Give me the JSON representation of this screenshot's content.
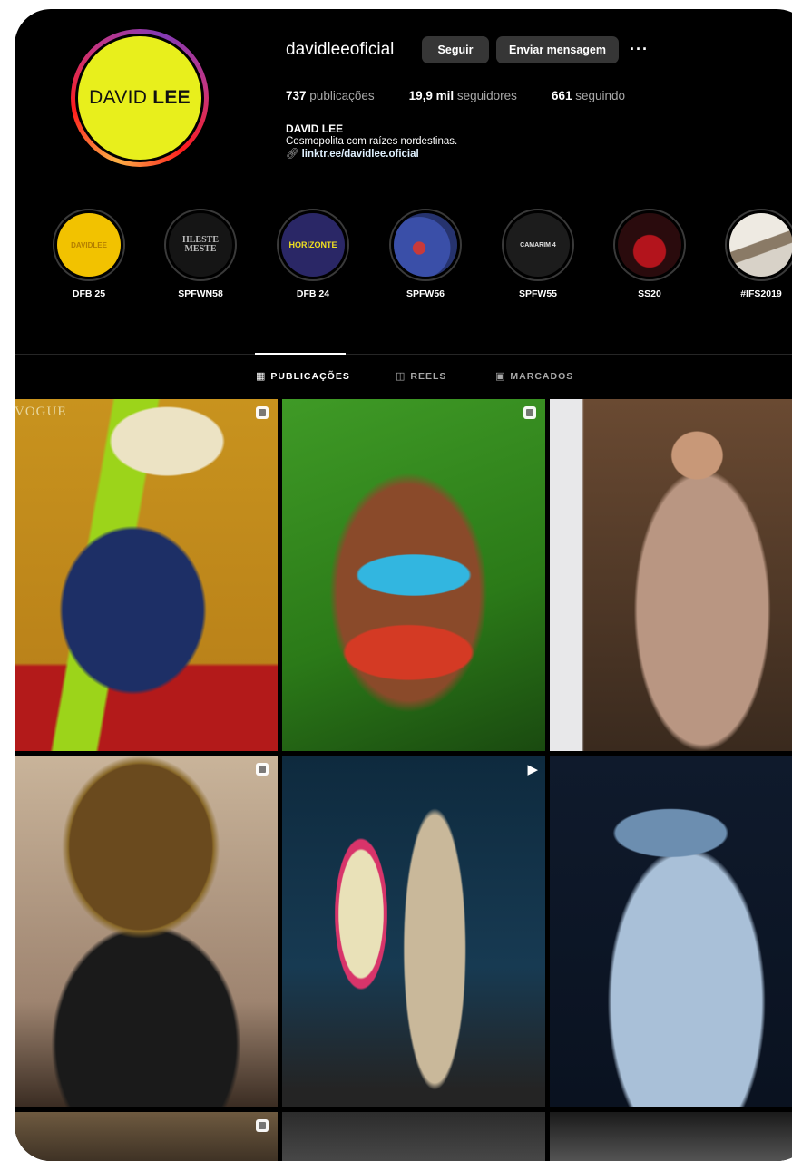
{
  "profile": {
    "username": "davidleeoficial",
    "avatar_text_light": "DAVID",
    "avatar_text_bold": "LEE",
    "follow_label": "Seguir",
    "message_label": "Enviar mensagem",
    "more_label": "···",
    "stats": {
      "posts_value": "737",
      "posts_label": "publicações",
      "followers_value": "19,9 mil",
      "followers_label": "seguidores",
      "following_value": "661",
      "following_label": "seguindo"
    },
    "bio": {
      "name": "DAVID LEE",
      "text": "Cosmopolita com raízes nordestinas.",
      "link": "linktr.ee/davidlee.oficial"
    }
  },
  "highlights": [
    {
      "label": "DFB 25",
      "cover_text": "DAVIDLEE"
    },
    {
      "label": "SPFWN58",
      "cover_text": "HLESTE MESTE"
    },
    {
      "label": "DFB 24",
      "cover_text": "HORIZONTE"
    },
    {
      "label": "SPFW56",
      "cover_text": ""
    },
    {
      "label": "SPFW55",
      "cover_text": "CAMARIM 4"
    },
    {
      "label": "SS20",
      "cover_text": ""
    },
    {
      "label": "#IFS2019",
      "cover_text": ""
    }
  ],
  "tabs": [
    {
      "label": "PUBLICAÇÕES",
      "icon": "grid-icon",
      "active": true
    },
    {
      "label": "REELS",
      "icon": "reels-icon",
      "active": false
    },
    {
      "label": "MARCADOS",
      "icon": "tagged-icon",
      "active": false
    }
  ],
  "posts": [
    {
      "type": "carousel",
      "overlay_text": "VOGUE"
    },
    {
      "type": "carousel"
    },
    {
      "type": "post"
    },
    {
      "type": "carousel"
    },
    {
      "type": "reel"
    },
    {
      "type": "post"
    },
    {
      "type": "carousel"
    },
    {
      "type": "post"
    },
    {
      "type": "post"
    }
  ],
  "colors": {
    "background": "#000000",
    "button": "#363636",
    "avatar_yellow": "#e8ef1c",
    "muted_text": "#a8a8a8",
    "link": "#e0f1ff"
  }
}
